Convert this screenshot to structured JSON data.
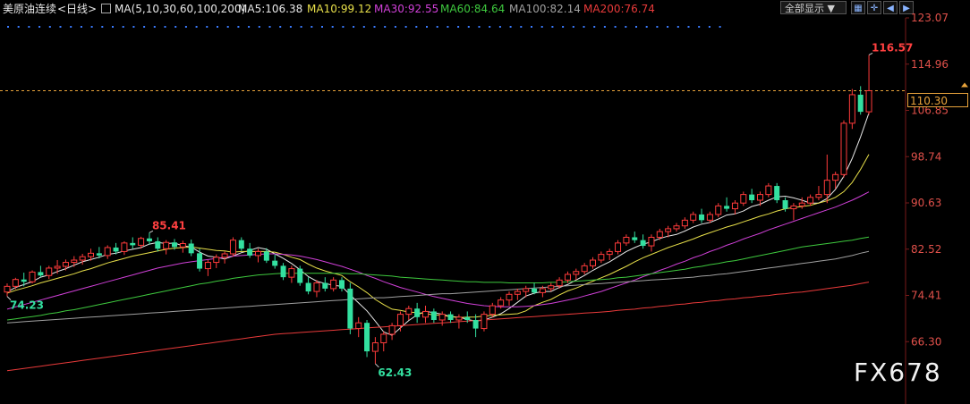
{
  "header": {
    "title": "美原油连续",
    "period": "<日线>",
    "ma_params": "MA(5,10,30,60,100,200)",
    "ma_values": [
      {
        "label": "MA5:106.38",
        "color": "#e8e8e8"
      },
      {
        "label": "MA10:99.12",
        "color": "#e8e04a"
      },
      {
        "label": "MA30:92.55",
        "color": "#d040d8"
      },
      {
        "label": "MA60:84.64",
        "color": "#3ec93e"
      },
      {
        "label": "MA100:82.14",
        "color": "#a0a0a0"
      },
      {
        "label": "MA200:76.74",
        "color": "#e83a3a"
      }
    ],
    "dropdown_label": "全部显示 ▼",
    "tool_icons": [
      "grid-icon",
      "crosshair-icon",
      "back-icon",
      "forward-icon"
    ]
  },
  "current_price": "110.30",
  "watermark": "FX678",
  "chart_data": {
    "type": "candlestick",
    "title": "美原油连续 <日线>",
    "y_ticks": [
      "123.07",
      "114.96",
      "106.85",
      "98.74",
      "90.63",
      "82.52",
      "74.41",
      "66.30"
    ],
    "ylim": [
      58.19,
      123.07
    ],
    "current_price": 110.3,
    "annotations": [
      {
        "text": "85.41",
        "value": 85.41,
        "type": "high"
      },
      {
        "text": "74.23",
        "value": 74.23,
        "type": "low"
      },
      {
        "text": "62.43",
        "value": 62.43,
        "type": "low"
      },
      {
        "text": "116.57",
        "value": 116.57,
        "type": "high"
      }
    ],
    "candles": [
      [
        75.0,
        76.5,
        74.23,
        76.0
      ],
      [
        76.0,
        77.5,
        75.5,
        77.2
      ],
      [
        77.2,
        78.4,
        76.0,
        76.8
      ],
      [
        76.8,
        78.8,
        76.5,
        78.5
      ],
      [
        78.5,
        79.6,
        77.6,
        77.9
      ],
      [
        77.9,
        79.6,
        77.3,
        79.2
      ],
      [
        79.2,
        80.6,
        78.2,
        79.5
      ],
      [
        79.5,
        80.7,
        78.8,
        80.2
      ],
      [
        80.2,
        81.3,
        79.4,
        80.6
      ],
      [
        80.6,
        81.7,
        79.8,
        81.2
      ],
      [
        81.2,
        82.6,
        80.5,
        81.8
      ],
      [
        81.8,
        82.9,
        80.9,
        81.4
      ],
      [
        81.4,
        83.2,
        80.8,
        82.8
      ],
      [
        82.8,
        83.6,
        81.6,
        82.1
      ],
      [
        82.1,
        83.9,
        81.5,
        83.6
      ],
      [
        83.6,
        84.6,
        82.6,
        83.2
      ],
      [
        83.2,
        84.7,
        82.6,
        84.4
      ],
      [
        84.4,
        85.41,
        83.3,
        83.9
      ],
      [
        83.9,
        84.6,
        82.1,
        82.6
      ],
      [
        82.6,
        84.1,
        81.6,
        83.7
      ],
      [
        83.7,
        84.3,
        82.4,
        82.9
      ],
      [
        82.9,
        84.0,
        81.9,
        83.5
      ],
      [
        83.5,
        84.2,
        81.3,
        81.8
      ],
      [
        81.8,
        82.6,
        78.6,
        79.1
      ],
      [
        79.1,
        80.6,
        77.8,
        80.2
      ],
      [
        80.2,
        81.6,
        79.2,
        81.1
      ],
      [
        81.1,
        82.1,
        80.0,
        81.7
      ],
      [
        81.7,
        84.6,
        81.2,
        84.1
      ],
      [
        84.1,
        84.6,
        82.2,
        82.6
      ],
      [
        82.6,
        83.6,
        81.0,
        81.4
      ],
      [
        81.4,
        82.6,
        80.2,
        82.1
      ],
      [
        82.1,
        82.7,
        80.1,
        80.5
      ],
      [
        80.5,
        81.6,
        79.1,
        79.6
      ],
      [
        79.6,
        80.1,
        77.1,
        77.6
      ],
      [
        77.6,
        79.6,
        76.6,
        79.1
      ],
      [
        79.1,
        79.6,
        76.1,
        76.6
      ],
      [
        76.6,
        77.6,
        74.6,
        75.1
      ],
      [
        75.1,
        77.1,
        74.1,
        76.6
      ],
      [
        76.6,
        77.6,
        75.1,
        75.6
      ],
      [
        75.6,
        77.6,
        75.1,
        77.1
      ],
      [
        77.1,
        77.6,
        75.1,
        75.6
      ],
      [
        75.6,
        76.6,
        67.6,
        68.6
      ],
      [
        68.6,
        70.6,
        67.1,
        69.6
      ],
      [
        69.6,
        70.1,
        63.6,
        64.6
      ],
      [
        64.6,
        67.1,
        62.43,
        66.1
      ],
      [
        66.1,
        68.1,
        64.6,
        67.6
      ],
      [
        67.6,
        69.6,
        66.6,
        69.1
      ],
      [
        69.1,
        71.6,
        68.1,
        71.1
      ],
      [
        71.1,
        72.6,
        70.1,
        72.1
      ],
      [
        72.1,
        73.1,
        69.6,
        70.6
      ],
      [
        70.6,
        72.6,
        69.6,
        71.6
      ],
      [
        71.6,
        72.1,
        69.6,
        70.1
      ],
      [
        70.1,
        71.6,
        69.1,
        71.1
      ],
      [
        71.1,
        71.6,
        69.6,
        70.1
      ],
      [
        70.1,
        71.1,
        68.6,
        70.6
      ],
      [
        70.6,
        71.6,
        69.6,
        70.1
      ],
      [
        70.1,
        71.1,
        67.1,
        68.6
      ],
      [
        68.6,
        71.6,
        68.1,
        71.1
      ],
      [
        71.1,
        73.1,
        70.6,
        72.6
      ],
      [
        72.6,
        74.1,
        72.1,
        73.6
      ],
      [
        73.6,
        75.1,
        72.6,
        74.6
      ],
      [
        74.6,
        75.6,
        73.6,
        75.1
      ],
      [
        75.1,
        76.1,
        74.1,
        75.6
      ],
      [
        75.6,
        76.6,
        74.6,
        74.9
      ],
      [
        74.9,
        76.1,
        74.1,
        75.6
      ],
      [
        75.6,
        76.6,
        75.1,
        76.1
      ],
      [
        76.1,
        77.6,
        75.6,
        77.1
      ],
      [
        77.1,
        78.6,
        76.6,
        78.1
      ],
      [
        78.1,
        79.1,
        77.1,
        78.6
      ],
      [
        78.6,
        80.1,
        78.1,
        79.6
      ],
      [
        79.6,
        81.1,
        79.1,
        80.6
      ],
      [
        80.6,
        82.1,
        80.1,
        81.6
      ],
      [
        81.6,
        82.6,
        80.6,
        82.1
      ],
      [
        82.1,
        84.1,
        81.6,
        83.6
      ],
      [
        83.6,
        85.1,
        83.1,
        84.6
      ],
      [
        84.6,
        85.6,
        83.6,
        84.1
      ],
      [
        84.1,
        85.1,
        82.6,
        83.1
      ],
      [
        83.1,
        85.1,
        82.1,
        84.6
      ],
      [
        84.6,
        86.1,
        84.1,
        85.6
      ],
      [
        85.6,
        86.6,
        84.6,
        86.1
      ],
      [
        86.1,
        87.1,
        85.6,
        86.6
      ],
      [
        86.6,
        88.1,
        86.1,
        87.6
      ],
      [
        87.6,
        89.1,
        87.1,
        88.6
      ],
      [
        88.6,
        89.6,
        87.1,
        87.6
      ],
      [
        87.6,
        89.1,
        87.1,
        88.6
      ],
      [
        88.6,
        90.6,
        88.1,
        90.1
      ],
      [
        90.1,
        91.6,
        89.1,
        89.6
      ],
      [
        89.6,
        91.1,
        88.6,
        90.6
      ],
      [
        90.6,
        92.6,
        90.1,
        92.1
      ],
      [
        92.1,
        93.1,
        90.6,
        91.1
      ],
      [
        91.1,
        92.6,
        90.1,
        92.1
      ],
      [
        92.1,
        94.1,
        91.6,
        93.6
      ],
      [
        93.6,
        94.1,
        90.6,
        91.1
      ],
      [
        91.1,
        91.6,
        89.1,
        89.6
      ],
      [
        89.6,
        90.6,
        87.6,
        90.1
      ],
      [
        90.1,
        91.6,
        89.6,
        90.6
      ],
      [
        90.6,
        92.1,
        90.1,
        91.6
      ],
      [
        91.6,
        93.6,
        91.1,
        92.1
      ],
      [
        92.1,
        99.1,
        90.6,
        94.6
      ],
      [
        94.6,
        96.1,
        93.1,
        95.6
      ],
      [
        95.6,
        105.1,
        95.1,
        104.6
      ],
      [
        104.6,
        110.6,
        103.6,
        109.6
      ],
      [
        109.6,
        111.1,
        106.1,
        106.6
      ],
      [
        106.6,
        116.57,
        106.1,
        110.3
      ]
    ],
    "series": [
      {
        "name": "MA5",
        "color": "#e8e8e8",
        "value": 106.38,
        "values": [
          75.0,
          75.8,
          76.3,
          76.8,
          77.6,
          78.0,
          78.6,
          79.1,
          79.7,
          80.3,
          80.7,
          81.1,
          81.6,
          81.8,
          82.2,
          82.5,
          82.8,
          83.4,
          83.7,
          83.5,
          83.6,
          83.1,
          82.9,
          82.0,
          81.3,
          81.1,
          80.8,
          81.3,
          81.9,
          82.3,
          82.8,
          82.5,
          81.7,
          80.9,
          80.0,
          78.9,
          77.7,
          76.9,
          76.5,
          76.2,
          76.0,
          74.5,
          73.1,
          71.7,
          69.9,
          68.0,
          67.4,
          68.7,
          70.0,
          71.0,
          71.6,
          71.4,
          71.1,
          70.7,
          70.6,
          70.2,
          69.9,
          70.1,
          70.6,
          71.2,
          72.1,
          73.2,
          74.3,
          74.8,
          75.1,
          75.1,
          75.8,
          76.3,
          77.1,
          77.9,
          78.8,
          79.6,
          80.3,
          81.2,
          82.1,
          82.8,
          83.4,
          83.8,
          84.4,
          84.8,
          85.1,
          85.7,
          86.4,
          86.9,
          87.2,
          87.8,
          88.5,
          88.7,
          89.2,
          90.0,
          90.4,
          91.1,
          91.7,
          91.8,
          91.5,
          91.1,
          90.6,
          90.6,
          91.4,
          93.0,
          95.3,
          98.4,
          102.2,
          106.38
        ]
      },
      {
        "name": "MA10",
        "color": "#e8e04a",
        "value": 99.12,
        "values": [
          74.8,
          75.3,
          75.7,
          76.1,
          76.6,
          77.0,
          77.4,
          77.8,
          78.2,
          78.7,
          79.1,
          79.6,
          80.1,
          80.5,
          80.9,
          81.3,
          81.6,
          81.9,
          82.2,
          82.5,
          82.7,
          82.8,
          82.9,
          82.7,
          82.5,
          82.3,
          82.2,
          82.0,
          82.1,
          82.1,
          82.1,
          82.1,
          82.0,
          81.6,
          81.1,
          80.7,
          79.9,
          79.2,
          78.7,
          78.3,
          77.9,
          76.8,
          75.9,
          74.9,
          73.7,
          72.8,
          72.0,
          71.8,
          71.5,
          71.4,
          71.2,
          71.0,
          70.9,
          70.7,
          70.5,
          70.6,
          70.6,
          70.8,
          70.9,
          71.0,
          71.1,
          71.2,
          71.7,
          72.6,
          73.2,
          73.7,
          74.5,
          75.2,
          75.7,
          76.3,
          76.9,
          77.5,
          78.1,
          78.8,
          79.5,
          80.3,
          81.0,
          81.6,
          82.2,
          82.8,
          83.3,
          83.8,
          84.3,
          84.9,
          85.4,
          85.9,
          86.4,
          86.8,
          87.3,
          87.8,
          88.3,
          88.7,
          89.2,
          89.6,
          89.8,
          90.0,
          90.2,
          90.6,
          91.0,
          91.6,
          92.6,
          94.2,
          96.5,
          99.12
        ]
      },
      {
        "name": "MA30",
        "color": "#d040d8",
        "value": 92.55,
        "values": [
          72.0,
          72.4,
          72.8,
          73.2,
          73.6,
          74.0,
          74.4,
          74.8,
          75.2,
          75.6,
          76.0,
          76.4,
          76.8,
          77.2,
          77.6,
          78.0,
          78.4,
          78.8,
          79.2,
          79.5,
          79.8,
          80.1,
          80.3,
          80.5,
          80.7,
          80.9,
          81.1,
          81.3,
          81.4,
          81.5,
          81.6,
          81.7,
          81.7,
          81.6,
          81.5,
          81.3,
          81.0,
          80.7,
          80.3,
          79.9,
          79.5,
          79.0,
          78.5,
          77.9,
          77.4,
          76.8,
          76.3,
          75.8,
          75.4,
          75.0,
          74.6,
          74.2,
          73.9,
          73.6,
          73.3,
          73.0,
          72.8,
          72.6,
          72.5,
          72.4,
          72.4,
          72.4,
          72.5,
          72.6,
          72.8,
          73.0,
          73.3,
          73.6,
          73.9,
          74.3,
          74.7,
          75.1,
          75.6,
          76.1,
          76.6,
          77.1,
          77.7,
          78.2,
          78.8,
          79.3,
          79.9,
          80.4,
          81.0,
          81.5,
          82.1,
          82.6,
          83.2,
          83.7,
          84.3,
          84.8,
          85.3,
          85.9,
          86.4,
          86.9,
          87.4,
          87.9,
          88.4,
          88.9,
          89.4,
          89.9,
          90.5,
          91.1,
          91.8,
          92.55
        ]
      },
      {
        "name": "MA60",
        "color": "#3ec93e",
        "value": 84.64,
        "values": [
          70.1,
          70.3,
          70.5,
          70.7,
          70.9,
          71.2,
          71.4,
          71.7,
          71.9,
          72.2,
          72.5,
          72.8,
          73.1,
          73.4,
          73.7,
          74.0,
          74.3,
          74.6,
          74.9,
          75.2,
          75.5,
          75.8,
          76.1,
          76.4,
          76.6,
          76.9,
          77.1,
          77.4,
          77.6,
          77.8,
          78.0,
          78.1,
          78.2,
          78.3,
          78.3,
          78.3,
          78.3,
          78.3,
          78.3,
          78.3,
          78.3,
          78.2,
          78.2,
          78.1,
          78.0,
          77.9,
          77.8,
          77.6,
          77.5,
          77.4,
          77.3,
          77.2,
          77.1,
          77.0,
          76.9,
          76.8,
          76.8,
          76.7,
          76.7,
          76.7,
          76.6,
          76.6,
          76.6,
          76.6,
          76.6,
          76.7,
          76.7,
          76.8,
          76.9,
          77.0,
          77.1,
          77.2,
          77.3,
          77.5,
          77.6,
          77.8,
          78.0,
          78.2,
          78.4,
          78.6,
          78.8,
          79.0,
          79.3,
          79.5,
          79.8,
          80.0,
          80.3,
          80.5,
          80.8,
          81.1,
          81.4,
          81.7,
          82.0,
          82.3,
          82.6,
          82.9,
          83.1,
          83.3,
          83.5,
          83.7,
          83.9,
          84.1,
          84.4,
          84.64
        ]
      },
      {
        "name": "MA100",
        "color": "#a0a0a0",
        "value": 82.14,
        "values": [
          69.6,
          69.7,
          69.8,
          69.9,
          70.0,
          70.1,
          70.2,
          70.3,
          70.4,
          70.5,
          70.6,
          70.7,
          70.8,
          70.9,
          71.0,
          71.1,
          71.2,
          71.3,
          71.4,
          71.5,
          71.6,
          71.7,
          71.8,
          71.9,
          72.0,
          72.1,
          72.2,
          72.3,
          72.4,
          72.5,
          72.6,
          72.7,
          72.8,
          72.9,
          73.0,
          73.1,
          73.2,
          73.3,
          73.4,
          73.5,
          73.6,
          73.7,
          73.8,
          73.9,
          74.0,
          74.0,
          74.1,
          74.2,
          74.3,
          74.4,
          74.5,
          74.6,
          74.7,
          74.7,
          74.8,
          74.9,
          75.0,
          75.1,
          75.2,
          75.3,
          75.4,
          75.5,
          75.6,
          75.7,
          75.8,
          75.9,
          76.0,
          76.1,
          76.2,
          76.3,
          76.4,
          76.5,
          76.6,
          76.7,
          76.8,
          76.9,
          77.0,
          77.1,
          77.2,
          77.3,
          77.4,
          77.5,
          77.6,
          77.8,
          77.9,
          78.1,
          78.2,
          78.4,
          78.6,
          78.8,
          79.0,
          79.2,
          79.4,
          79.6,
          79.8,
          80.0,
          80.2,
          80.4,
          80.6,
          80.8,
          81.1,
          81.4,
          81.8,
          82.14
        ]
      },
      {
        "name": "MA200",
        "color": "#e83a3a",
        "value": 76.74,
        "values": [
          61.2,
          61.4,
          61.6,
          61.8,
          62.0,
          62.2,
          62.4,
          62.6,
          62.8,
          63.0,
          63.2,
          63.4,
          63.6,
          63.8,
          64.0,
          64.2,
          64.4,
          64.6,
          64.8,
          65.0,
          65.2,
          65.4,
          65.6,
          65.8,
          66.0,
          66.2,
          66.4,
          66.6,
          66.8,
          67.0,
          67.2,
          67.4,
          67.6,
          67.7,
          67.8,
          67.9,
          68.0,
          68.1,
          68.2,
          68.3,
          68.4,
          68.5,
          68.6,
          68.7,
          68.8,
          68.9,
          69.0,
          69.1,
          69.2,
          69.3,
          69.4,
          69.5,
          69.6,
          69.7,
          69.8,
          69.9,
          70.0,
          70.1,
          70.2,
          70.3,
          70.4,
          70.5,
          70.6,
          70.7,
          70.8,
          70.9,
          71.0,
          71.1,
          71.2,
          71.3,
          71.4,
          71.5,
          71.6,
          71.8,
          71.9,
          72.0,
          72.2,
          72.3,
          72.5,
          72.6,
          72.8,
          72.9,
          73.1,
          73.2,
          73.4,
          73.5,
          73.7,
          73.8,
          74.0,
          74.1,
          74.3,
          74.4,
          74.6,
          74.7,
          74.9,
          75.0,
          75.2,
          75.4,
          75.6,
          75.8,
          76.0,
          76.2,
          76.5,
          76.74
        ]
      }
    ]
  }
}
